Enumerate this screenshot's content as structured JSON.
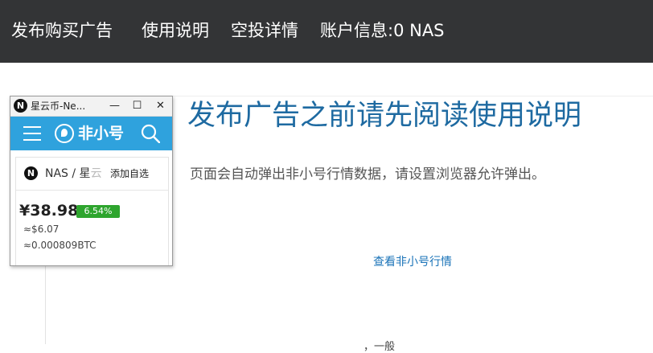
{
  "nav": {
    "items": [
      {
        "label": "发布购买广告"
      },
      {
        "label": "使用说明"
      },
      {
        "label": "空投详情"
      },
      {
        "label": "账户信息:0 NAS"
      }
    ]
  },
  "main": {
    "headline": "发布广告之前请先阅读使用说明",
    "notice": "页面会自动弹出非小号行情数据，请设置浏览器允许弹出。",
    "link_label": "查看非小号行情",
    "partial_text": "，一般"
  },
  "popup": {
    "window_title": "星云币-Ne...",
    "controls": {
      "minimize": "—",
      "maximize": "☐",
      "close": "✕"
    },
    "app_name": "非小号",
    "pair_label": "NAS / 星",
    "pair_cut": "云",
    "add_favorite": "添加自选",
    "price": "¥38.98",
    "change": "6.54%",
    "usd": "≈$6.07",
    "btc": "≈0.000809BTC",
    "logo_glyph": "N",
    "icons": [
      "menu-icon",
      "search-icon",
      "nebulas-logo-icon"
    ],
    "colors": {
      "header": "#2fa2dd",
      "badge": "#2ea52e",
      "topbar": "#333436",
      "headline": "#1e6aa1"
    }
  }
}
